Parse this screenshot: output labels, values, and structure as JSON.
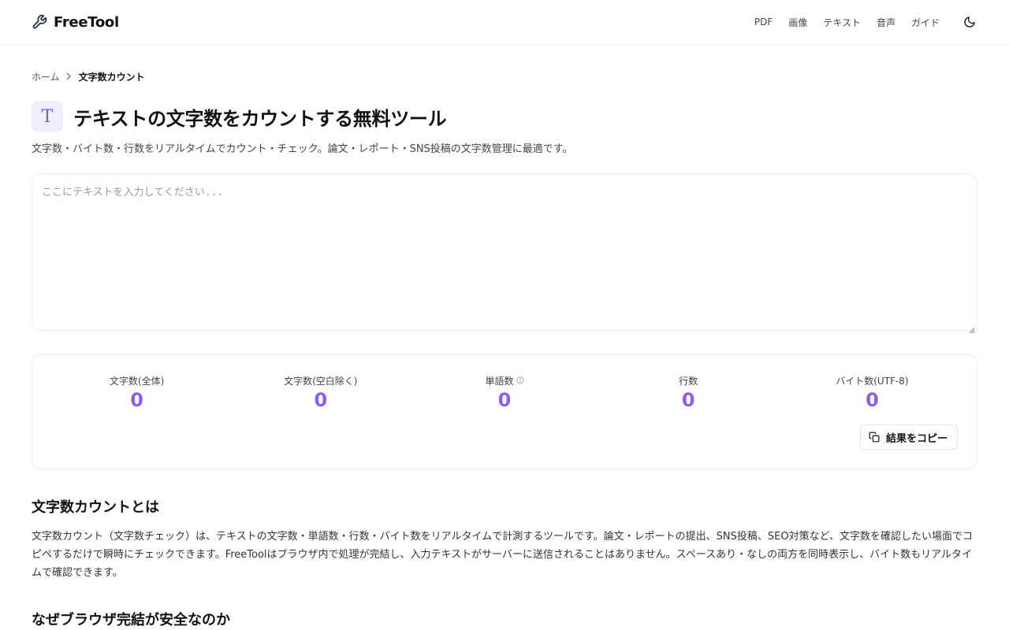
{
  "header": {
    "brand": "FreeTool",
    "nav": [
      "PDF",
      "画像",
      "テキスト",
      "音声",
      "ガイド"
    ]
  },
  "breadcrumb": {
    "home": "ホーム",
    "current": "文字数カウント"
  },
  "page": {
    "icon_letter": "T",
    "title": "テキストの文字数をカウントする無料ツール",
    "subtitle": "文字数・バイト数・行数をリアルタイムでカウント・チェック。論文・レポート・SNS投稿の文字数管理に最適です。"
  },
  "input": {
    "value": "",
    "placeholder": "ここにテキストを入力してください..."
  },
  "stats": [
    {
      "label": "文字数(全体)",
      "value": "0"
    },
    {
      "label": "文字数(空白除く)",
      "value": "0"
    },
    {
      "label": "単語数",
      "value": "0"
    },
    {
      "label": "行数",
      "value": "0"
    },
    {
      "label": "バイト数(UTF-8)",
      "value": "0"
    }
  ],
  "copy_button": "結果をコピー",
  "about": {
    "title": "文字数カウントとは",
    "body": "文字数カウント（文字数チェック）は、テキストの文字数・単語数・行数・バイト数をリアルタイムで計測するツールです。論文・レポートの提出、SNS投稿、SEO対策など、文字数を確認したい場面でコピペするだけで瞬時にチェックできます。FreeToolはブラウザ内で処理が完結し、入力テキストがサーバーに送信されることはありません。スペースあり・なしの両方を同時表示し、バイト数もリアルタイムで確認できます。"
  },
  "safety": {
    "title": "なぜブラウザ完結が安全なのか"
  },
  "colors": {
    "accent": "#8b5cf6",
    "icon_bg": "#f1eefb"
  }
}
